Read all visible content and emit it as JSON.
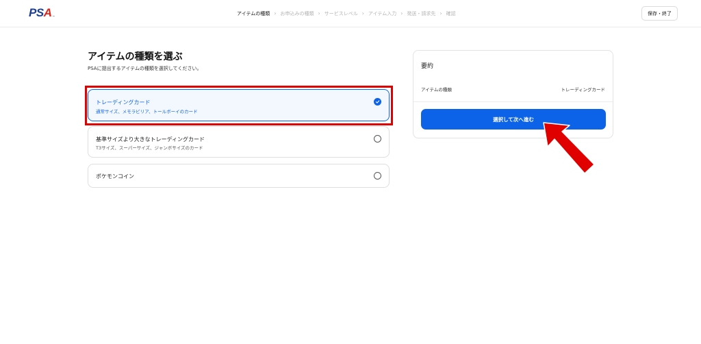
{
  "header": {
    "logo": {
      "text": "PSA",
      "mark": "™"
    },
    "steps": [
      {
        "label": "アイテムの種類",
        "active": true
      },
      {
        "label": "お申込みの種類",
        "active": false
      },
      {
        "label": "サービスレベル",
        "active": false
      },
      {
        "label": "アイテム入力",
        "active": false
      },
      {
        "label": "発送・請求先",
        "active": false
      },
      {
        "label": "確認",
        "active": false
      }
    ],
    "chevron_icon": "chevron-right-icon",
    "save_label": "保存・終了"
  },
  "main": {
    "title": "アイテムの種類を選ぶ",
    "subtitle": "PSAに提出するアイテムの種類を選択してください。",
    "options": [
      {
        "title": "トレーディングカード",
        "description": "通常サイズ、メモラビリア、トールボーイのカード",
        "selected": true
      },
      {
        "title": "基準サイズより大きなトレーディングカード",
        "description": "T3サイズ、スーパーサイズ、ジャンボサイズのカード",
        "selected": false
      },
      {
        "title": "ポケモンコイン",
        "description": "",
        "selected": false
      }
    ]
  },
  "summary": {
    "title": "要約",
    "item_type_label": "アイテムの種類",
    "item_type_value": "トレーディングカード",
    "next_label": "選択して次へ進む"
  },
  "colors": {
    "accent": "#0d63e8",
    "annotation": "#e00000",
    "logo_blue": "#1c3f94",
    "logo_red": "#e1251b"
  }
}
